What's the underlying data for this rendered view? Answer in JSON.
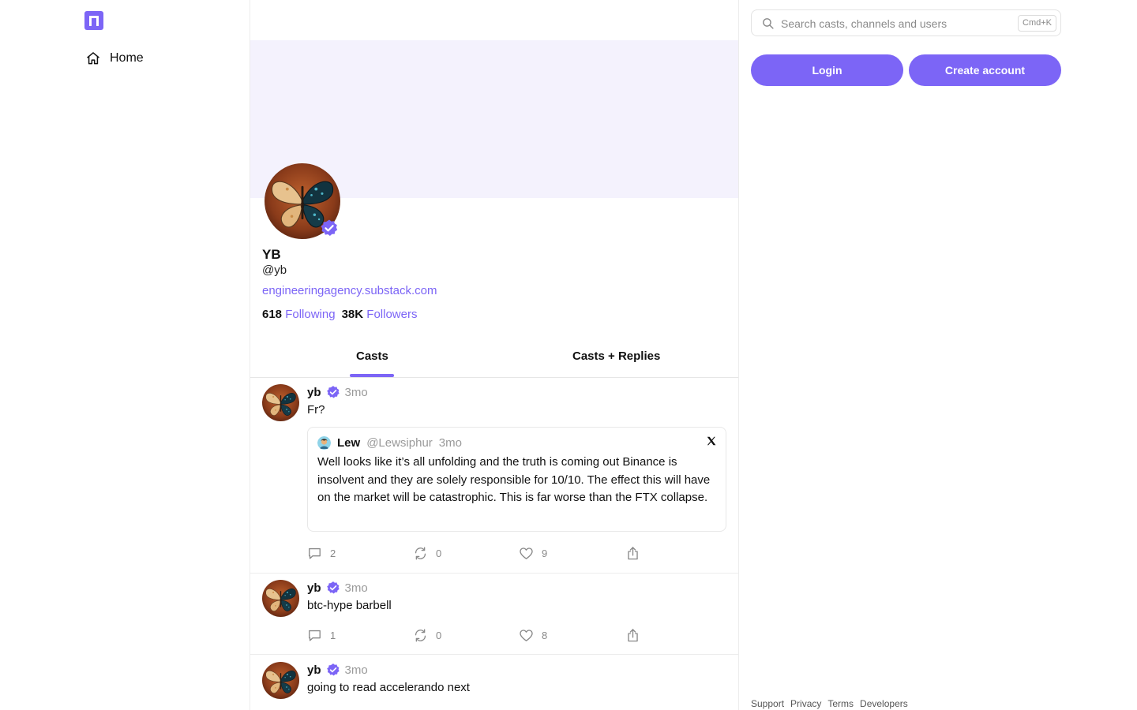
{
  "sidebar": {
    "logo_icon": "farcaster-logo-icon",
    "nav": [
      {
        "label": "Home",
        "icon": "home-icon"
      }
    ]
  },
  "profile": {
    "display_name": "YB",
    "handle": "@yb",
    "link": "engineeringagency.substack.com",
    "following_count": "618",
    "following_label": "Following",
    "followers_count": "38K",
    "followers_label": "Followers",
    "verified": true
  },
  "tabs": [
    {
      "label": "Casts",
      "active": true
    },
    {
      "label": "Casts + Replies",
      "active": false
    }
  ],
  "casts": [
    {
      "author": "yb",
      "time": "3mo",
      "text": "Fr?",
      "quote": {
        "author": "Lew",
        "handle": "@Lewsiphur",
        "time": "3mo",
        "source_icon": "x-icon",
        "text": "Well looks like it’s all unfolding and the truth is coming out Binance is insolvent and they are solely responsible for 10/10. The effect this will have on the market will be catastrophic. This is far worse than the FTX collapse."
      },
      "replies": "2",
      "recasts": "0",
      "likes": "9"
    },
    {
      "author": "yb",
      "time": "3mo",
      "text": "btc-hype barbell",
      "replies": "1",
      "recasts": "0",
      "likes": "8"
    },
    {
      "author": "yb",
      "time": "3mo",
      "text": "going to read accelerando next"
    }
  ],
  "search": {
    "placeholder": "Search casts, channels and users",
    "shortcut": "Cmd+K"
  },
  "auth": {
    "login_label": "Login",
    "create_label": "Create account"
  },
  "footer": {
    "links": [
      "Support",
      "Privacy",
      "Terms",
      "Developers"
    ]
  },
  "colors": {
    "accent": "#7c65f6",
    "banner": "#f4f2fd",
    "muted_text": "#9a9a9a"
  }
}
